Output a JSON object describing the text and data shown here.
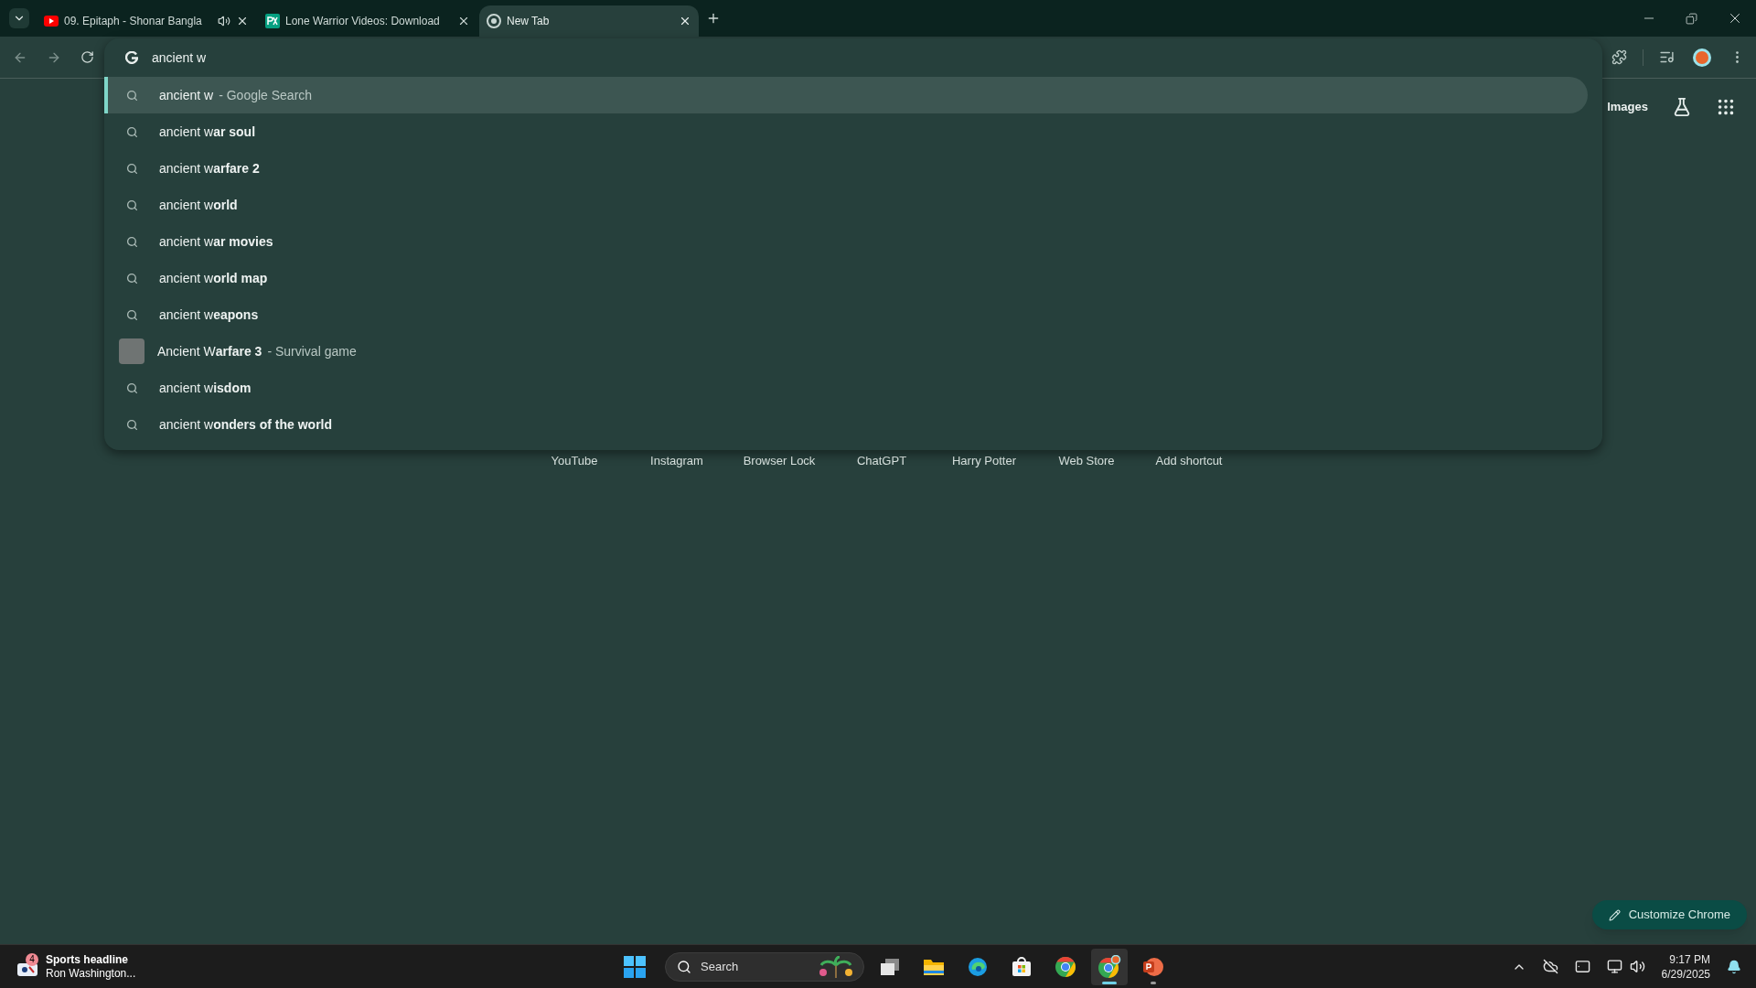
{
  "tabs": [
    {
      "kind": "video",
      "title": "09. Epitaph - Shonar Bangla",
      "audio_playing": true,
      "selected": false
    },
    {
      "kind": "stock",
      "title": "Lone Warrior Videos: Download",
      "audio_playing": false,
      "selected": false
    },
    {
      "kind": "newtab",
      "title": "New Tab",
      "audio_playing": false,
      "selected": true
    }
  ],
  "omnibox": {
    "value": "ancient w"
  },
  "suggestions": [
    {
      "kind": "search",
      "text": "ancient w",
      "description": "- Google Search",
      "selected": true
    },
    {
      "kind": "search",
      "text": "ancient w**ar soul**",
      "selected": false
    },
    {
      "kind": "search",
      "text": "ancient w**arfare 2**",
      "selected": false
    },
    {
      "kind": "search",
      "text": "ancient w**orld**",
      "selected": false
    },
    {
      "kind": "search",
      "text": "ancient w**ar movies**",
      "selected": false
    },
    {
      "kind": "search",
      "text": "ancient w**orld map**",
      "selected": false
    },
    {
      "kind": "search",
      "text": "ancient w**eapons**",
      "selected": false
    },
    {
      "kind": "entity",
      "text": "Ancient W**arfare 3**",
      "description": "- Survival game",
      "selected": false
    },
    {
      "kind": "search",
      "text": "ancient w**isdom**",
      "selected": false
    },
    {
      "kind": "search",
      "text": "ancient w**onders of the world**",
      "selected": false
    }
  ],
  "ntp": {
    "header_link": "Images",
    "shortcuts": [
      "YouTube",
      "Instagram",
      "Browser Lock",
      "ChatGPT",
      "Harry Potter",
      "Web Store",
      "Add shortcut"
    ],
    "customize_button": "Customize Chrome"
  },
  "taskbar": {
    "widget": {
      "badge": "4",
      "headline": "Sports headline",
      "subtitle": "Ron Washington..."
    },
    "search": {
      "placeholder": "Search"
    },
    "apps": [
      {
        "kind": "taskview",
        "selected": false,
        "running": false
      },
      {
        "kind": "explorer",
        "selected": false,
        "running": false
      },
      {
        "kind": "edge",
        "selected": false,
        "running": false
      },
      {
        "kind": "store",
        "selected": false,
        "running": false
      },
      {
        "kind": "chrome",
        "selected": false,
        "running": false
      },
      {
        "kind": "chrome-profile",
        "selected": true,
        "running": true
      },
      {
        "kind": "slides",
        "selected": false,
        "running": true
      }
    ],
    "time": "9:17 PM",
    "date": "6/29/2025"
  }
}
